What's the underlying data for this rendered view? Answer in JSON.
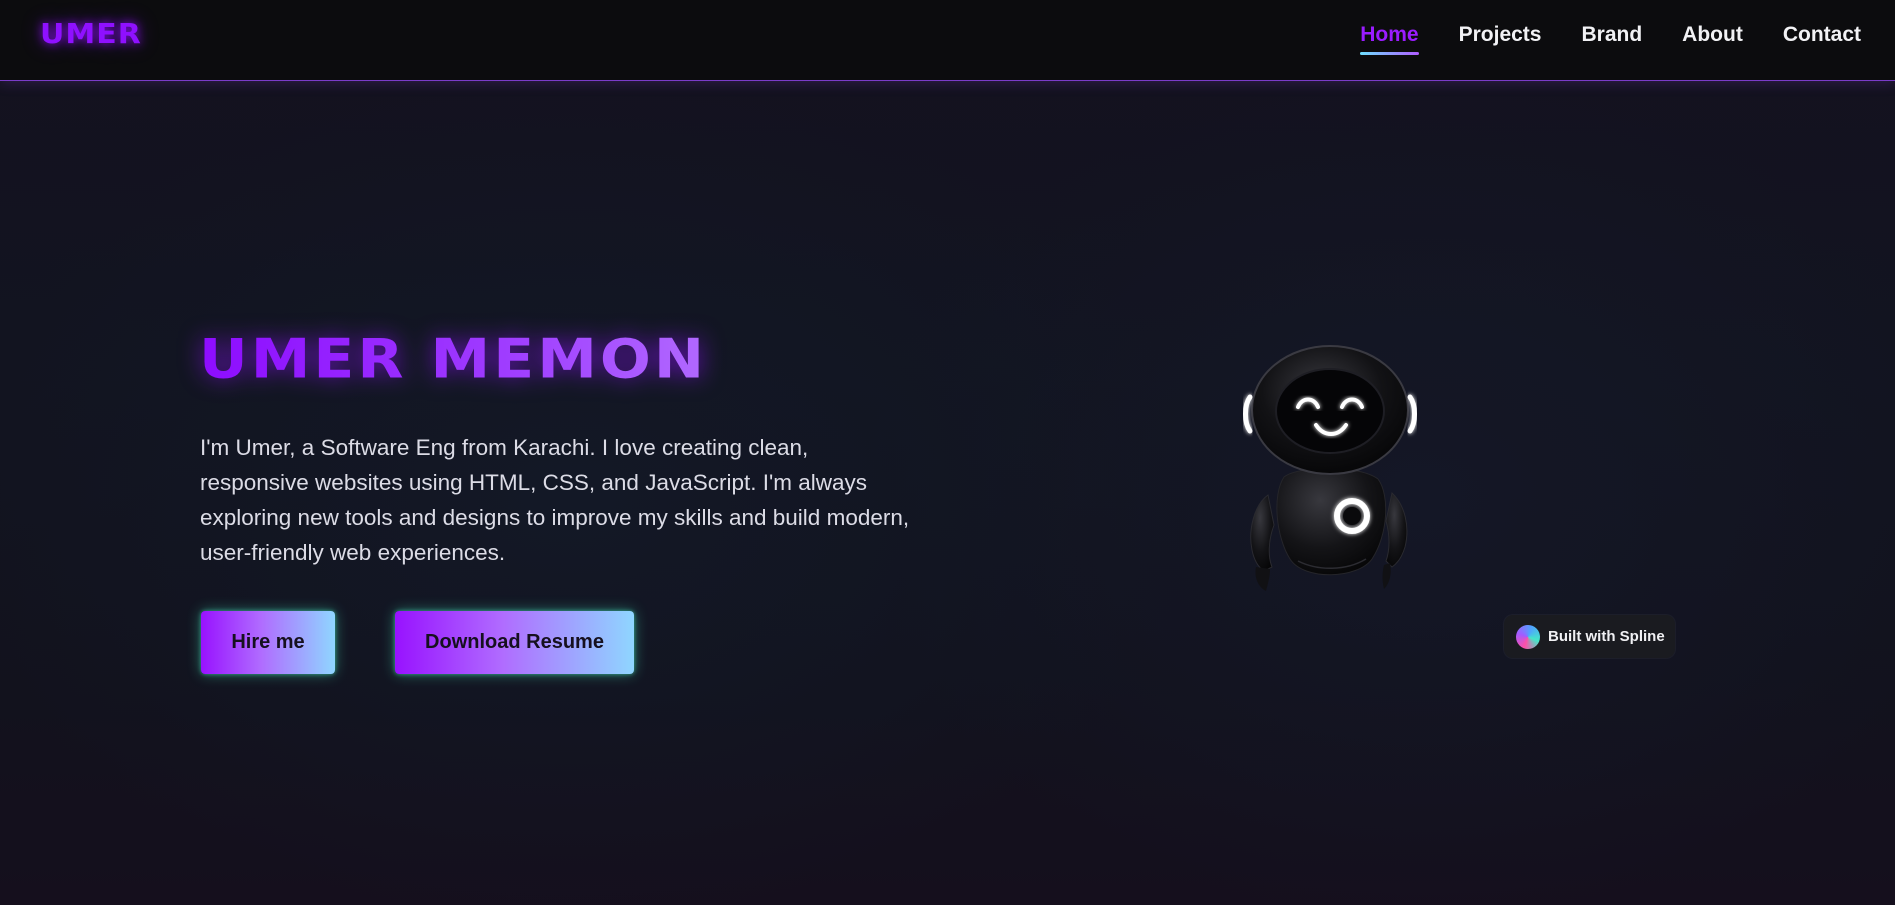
{
  "header": {
    "logo": "UMER",
    "nav": [
      {
        "label": "Home",
        "active": true
      },
      {
        "label": "Projects",
        "active": false
      },
      {
        "label": "Brand",
        "active": false
      },
      {
        "label": "About",
        "active": false
      },
      {
        "label": "Contact",
        "active": false
      }
    ]
  },
  "hero": {
    "title": "UMER MEMON",
    "description": "I'm Umer, a Software Eng from Karachi. I love creating clean, responsive websites using HTML, CSS, and JavaScript. I'm always exploring new tools and designs to improve my skills and build modern, user-friendly web experiences.",
    "buttons": {
      "hire": "Hire me",
      "resume": "Download Resume"
    }
  },
  "badge": {
    "text": "Built with Spline",
    "icon": "spline-logo-icon"
  },
  "colors": {
    "accent": "#8f10ff",
    "nav_underline": "#6ee0ff",
    "button_glow": "#46e6be",
    "background": "#12121d"
  }
}
